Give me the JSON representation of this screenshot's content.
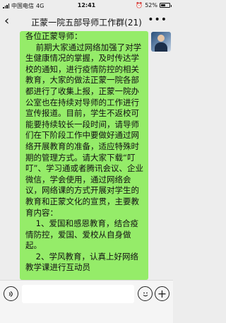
{
  "status_bar": {
    "carrier": "中国电信",
    "network": "4G",
    "time": "12:41",
    "battery": "52%",
    "battery_level": 0.52
  },
  "nav": {
    "back_icon": "chevron-left-icon",
    "title": "正蒙一院五部导师工作群(21)",
    "more_icon": "more-dots-icon"
  },
  "message": {
    "sender_avatar": "user-avatar",
    "text": "各位正蒙导师：\n    前期大家通过网络加强了对学生健康情况的掌握，及时传达学校的通知，进行疫情防控的相关教育，大家的做法正蒙一院各部都进行了收集上报，正蒙一院办公室也在持续对导师的工作进行宣传报道。目前，学生不返校可能要持续较长一段时间，请导师们在下阶段工作中要做好通过网络开展教育的准备，适应特殊时期的管理方式。请大家下载“叮叮”、学习通或者腾讯会议、企业微信，学会使用，通过网络会议，网络课的方式开展对学生的教育和正蒙文化的宣贯，主要教育内容：\n    1、爱国和感恩教育，结合疫情防控，爱国、爱校从自身做起。\n    2、学风教育，认真上好网络教学课进行互动员"
  },
  "input_bar": {
    "voice_icon": "voice-icon",
    "input_value": "",
    "emoji_icon": "emoji-icon",
    "plus_icon": "plus-icon"
  }
}
